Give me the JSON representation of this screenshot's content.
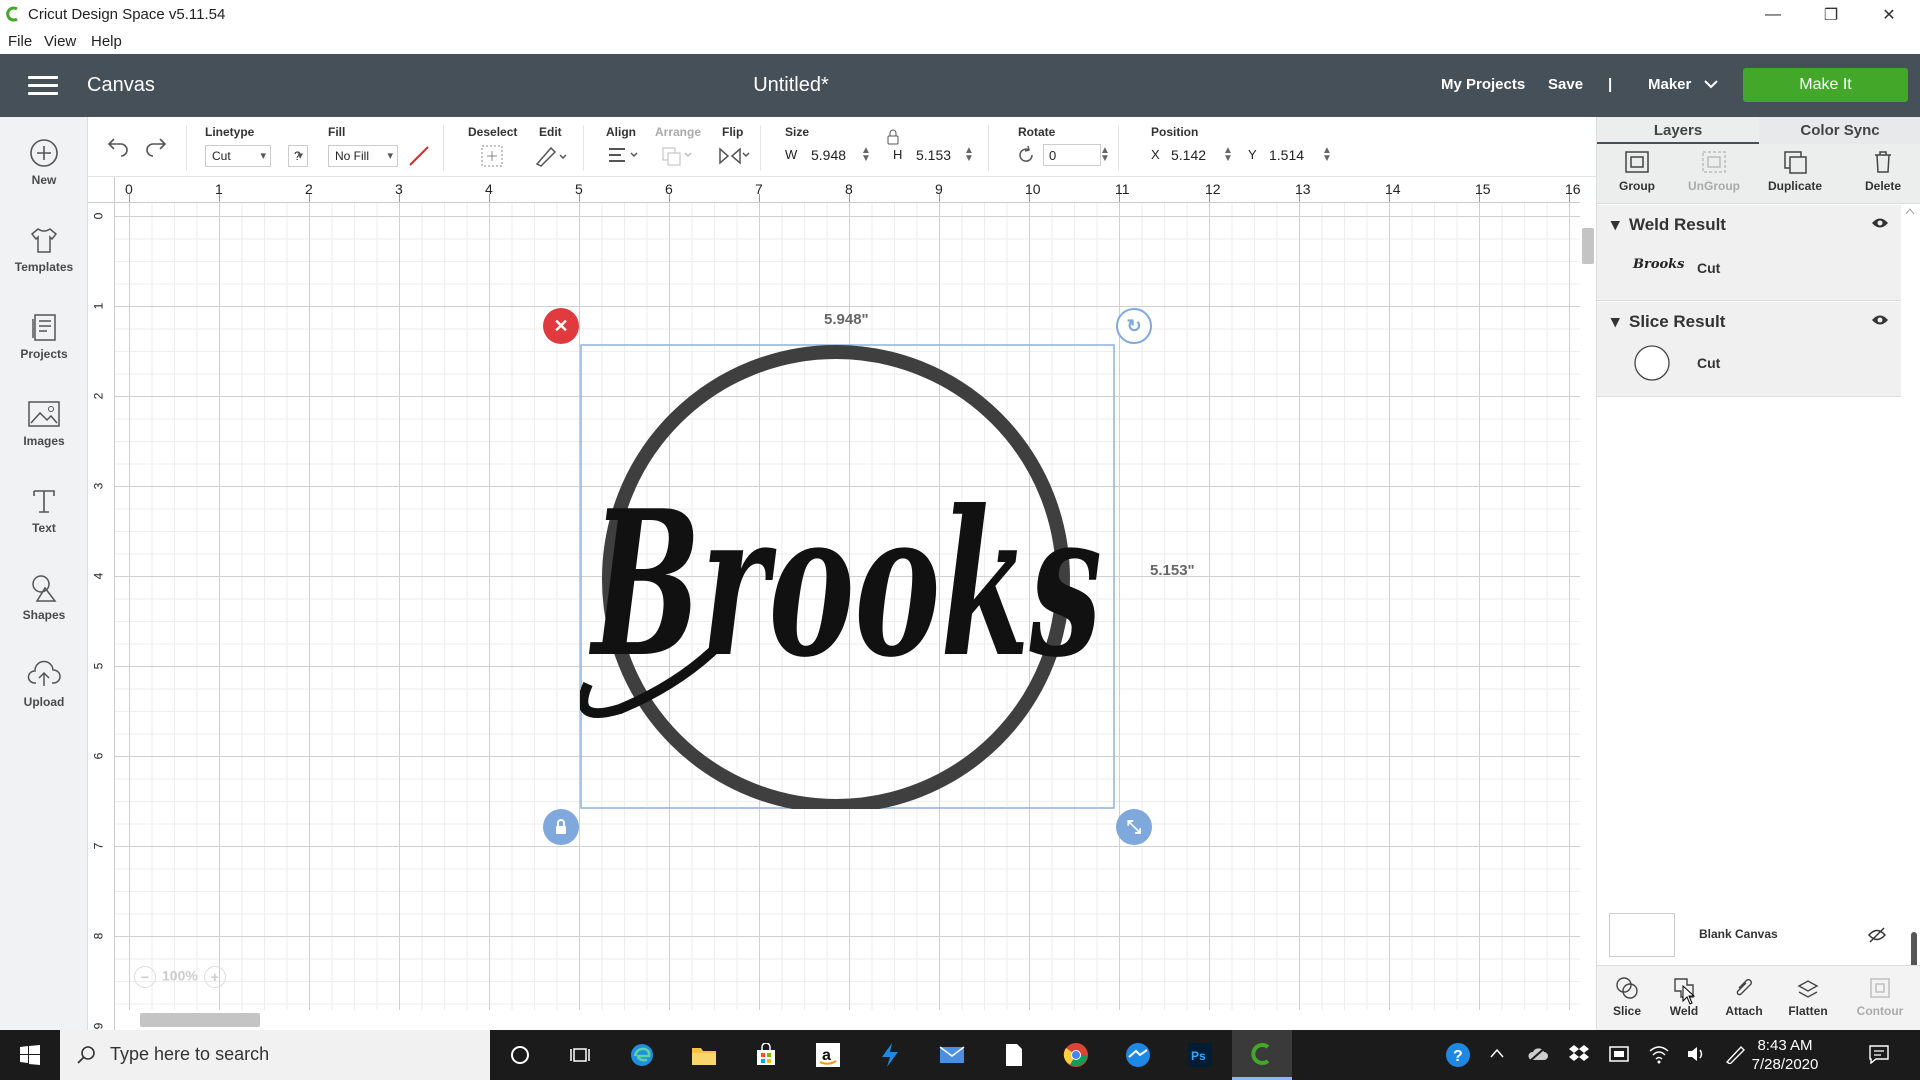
{
  "window": {
    "title": "Cricut Design Space  v5.11.54",
    "minimize": "—",
    "restore": "❐",
    "close": "✕"
  },
  "menu": [
    "File",
    "View",
    "Help"
  ],
  "header": {
    "section": "Canvas",
    "doc_title": "Untitled*",
    "my_projects": "My Projects",
    "save": "Save",
    "divider": "|",
    "machine": "Maker",
    "make_it": "Make It"
  },
  "sidebar": [
    {
      "label": "New",
      "icon": "plus-circle-icon"
    },
    {
      "label": "Templates",
      "icon": "shirt-icon"
    },
    {
      "label": "Projects",
      "icon": "projects-icon"
    },
    {
      "label": "Images",
      "icon": "image-icon"
    },
    {
      "label": "Text",
      "icon": "text-icon"
    },
    {
      "label": "Shapes",
      "icon": "shapes-icon"
    },
    {
      "label": "Upload",
      "icon": "upload-cloud-icon"
    }
  ],
  "toolbar": {
    "linetype_label": "Linetype",
    "linetype_value": "Cut",
    "linetype_help": "?",
    "fill_label": "Fill",
    "fill_value": "No Fill",
    "deselect_label": "Deselect",
    "edit_label": "Edit",
    "align_label": "Align",
    "arrange_label": "Arrange",
    "flip_label": "Flip",
    "size_label": "Size",
    "w_label": "W",
    "w_value": "5.948",
    "h_label": "H",
    "h_value": "5.153",
    "rotate_label": "Rotate",
    "rotate_value": "0",
    "position_label": "Position",
    "x_label": "X",
    "x_value": "5.142",
    "y_label": "Y",
    "y_value": "1.514"
  },
  "ruler": {
    "horizontal": [
      "0",
      "1",
      "2",
      "3",
      "4",
      "5",
      "6",
      "7",
      "8",
      "9",
      "10",
      "11",
      "12",
      "13",
      "14",
      "15",
      "16"
    ],
    "vertical": [
      "0",
      "1",
      "2",
      "3",
      "4",
      "5",
      "6",
      "7",
      "8",
      "9"
    ]
  },
  "canvas": {
    "width_label": "5.948\"",
    "height_label": "5.153\"",
    "design_text": "Brooks",
    "zoom": "100%",
    "zoom_minus": "−",
    "zoom_plus": "+"
  },
  "panel": {
    "tabs": [
      "Layers",
      "Color Sync"
    ],
    "actions": [
      {
        "label": "Group",
        "enabled": true
      },
      {
        "label": "UnGroup",
        "enabled": false
      },
      {
        "label": "Duplicate",
        "enabled": true
      },
      {
        "label": "Delete",
        "enabled": true
      }
    ],
    "layers": [
      {
        "name": "Weld Result",
        "sub": "Cut"
      },
      {
        "name": "Slice Result",
        "sub": "Cut"
      }
    ],
    "blank_canvas": "Blank Canvas",
    "bottom_actions": [
      {
        "label": "Slice",
        "enabled": true
      },
      {
        "label": "Weld",
        "enabled": true
      },
      {
        "label": "Attach",
        "enabled": true
      },
      {
        "label": "Flatten",
        "enabled": true
      },
      {
        "label": "Contour",
        "enabled": false
      }
    ]
  },
  "taskbar": {
    "search_placeholder": "Type here to search",
    "time": "8:43 AM",
    "date": "7/28/2020"
  },
  "colors": {
    "header": "#465058",
    "make_it": "#43a72a",
    "delete_handle": "#e0393e",
    "handle_blue": "#7fa8dc"
  }
}
